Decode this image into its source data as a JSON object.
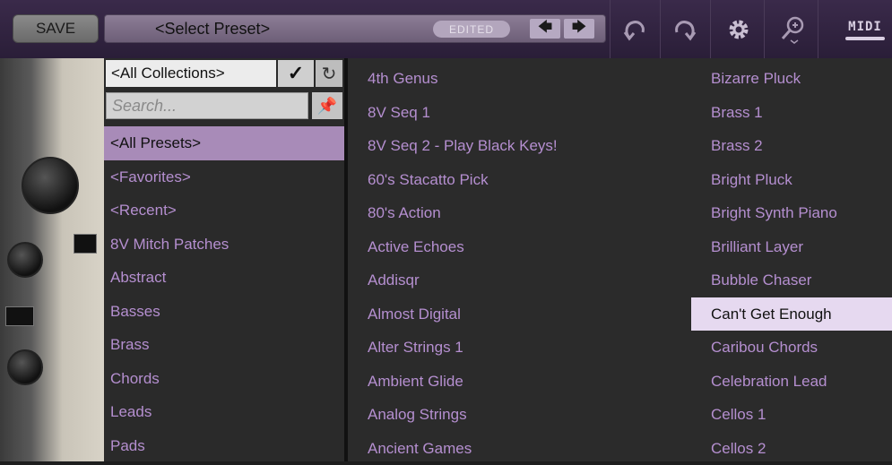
{
  "toolbar": {
    "save_label": "SAVE",
    "preset_name": "<Select Preset>",
    "edited_badge": "EDITED",
    "prev_icon": "arrow-left-icon",
    "next_icon": "arrow-right-icon",
    "undo_icon": "undo-icon",
    "redo_icon": "redo-icon",
    "settings_icon": "gear-icon",
    "zoom_icon": "zoom-icon",
    "midi_label": "MIDI"
  },
  "browser": {
    "collection_selected": "<All Collections>",
    "search_placeholder": "Search...",
    "categories": [
      {
        "label": "<All Presets>",
        "selected": true
      },
      {
        "label": "<Favorites>"
      },
      {
        "label": "<Recent>"
      },
      {
        "label": "8V Mitch Patches"
      },
      {
        "label": "Abstract"
      },
      {
        "label": "Basses"
      },
      {
        "label": "Brass"
      },
      {
        "label": "Chords"
      },
      {
        "label": "Leads"
      },
      {
        "label": "Pads"
      }
    ],
    "presets_col1": [
      "4th Genus",
      "8V Seq 1",
      "8V Seq 2 - Play Black Keys!",
      "60's Stacatto Pick",
      "80's Action",
      "Active Echoes",
      "Addisqr",
      "Almost Digital",
      "Alter Strings 1",
      "Ambient Glide",
      "Analog Strings",
      "Ancient Games"
    ],
    "presets_col2": [
      {
        "label": "Bizarre Pluck"
      },
      {
        "label": "Brass 1"
      },
      {
        "label": "Brass 2"
      },
      {
        "label": "Bright Pluck"
      },
      {
        "label": "Bright Synth Piano"
      },
      {
        "label": "Brilliant Layer"
      },
      {
        "label": "Bubble Chaser"
      },
      {
        "label": "Can't Get Enough",
        "selected": true
      },
      {
        "label": "Caribou Chords"
      },
      {
        "label": "Celebration Lead"
      },
      {
        "label": "Cellos 1"
      },
      {
        "label": "Cellos 2"
      }
    ]
  },
  "colors": {
    "accent": "#b58fd0",
    "selected_category_bg": "#a88bb8",
    "selected_preset_bg": "#e6d9f0",
    "toolbar_bg": "#2a1e38"
  }
}
